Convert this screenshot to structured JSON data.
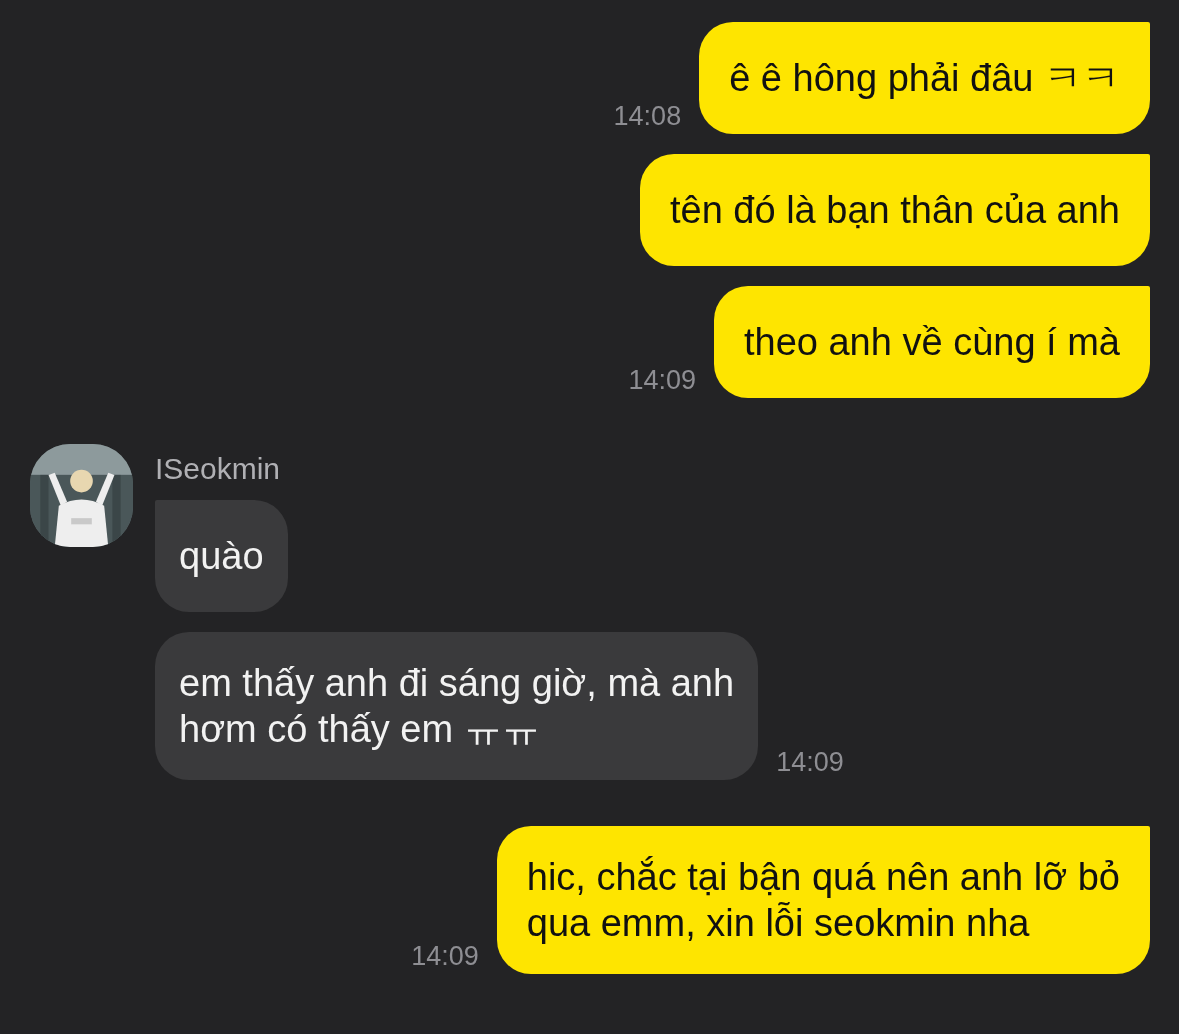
{
  "messages": [
    {
      "kind": "sent",
      "text": "ê ê hông phải đâu ㅋㅋ",
      "time": "14:08",
      "tail": true
    },
    {
      "kind": "sent",
      "text": "tên đó là bạn thân của anh",
      "tail": true
    },
    {
      "kind": "sent",
      "text": "theo anh về cùng í mà",
      "time": "14:09",
      "tail": true
    },
    {
      "kind": "received",
      "sender": "ISeokmin",
      "text": "quào",
      "tail": true
    },
    {
      "kind": "received",
      "text": "em thấy anh đi sáng giờ, mà anh\nhơm có thấy em ㅠㅠ",
      "time": "14:09",
      "tail": false
    },
    {
      "kind": "sent",
      "text": "hic, chắc tại bận quá nên anh lỡ bỏ\nqua emm, xin lỗi seokmin nha",
      "time": "14:09",
      "tail": true
    }
  ]
}
